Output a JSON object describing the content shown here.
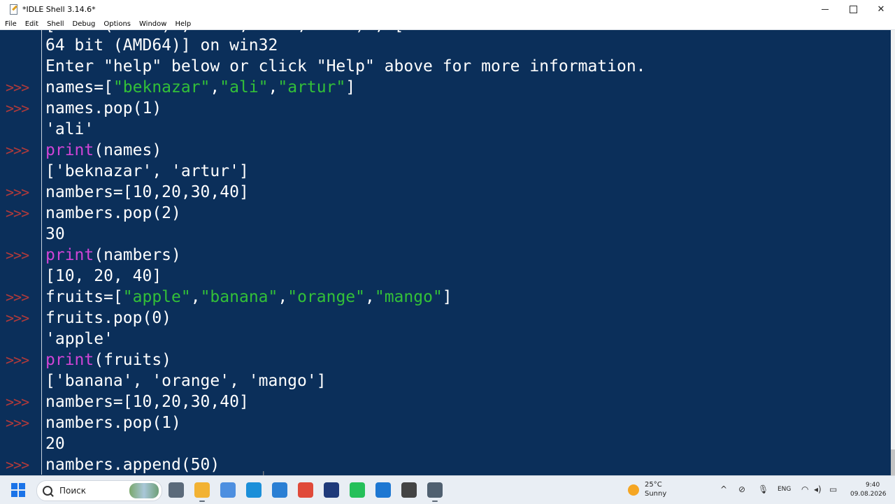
{
  "window": {
    "title": "*IDLE Shell 3.14.6*",
    "controls": {
      "minimize": "—",
      "maximize": "□",
      "close": "✕"
    }
  },
  "menu": [
    "File",
    "Edit",
    "Shell",
    "Debug",
    "Options",
    "Window",
    "Help"
  ],
  "shell": {
    "prompt": ">>>",
    "clipped_line": "[ ... ( ... ) , ... , ... , ... ) , [",
    "banner": [
      "64 bit (AMD64)] on win32",
      "Enter \"help\" below or click \"Help\" above for more information."
    ],
    "session": [
      {
        "kind": "input",
        "code": "names=[\"beknazar\",\"ali\",\"artur\"]"
      },
      {
        "kind": "input",
        "code": "names.pop(1)"
      },
      {
        "kind": "output",
        "code": "'ali'"
      },
      {
        "kind": "input",
        "code": "print(names)"
      },
      {
        "kind": "output",
        "code": "['beknazar', 'artur']"
      },
      {
        "kind": "input",
        "code": "nambers=[10,20,30,40]"
      },
      {
        "kind": "input",
        "code": "nambers.pop(2)"
      },
      {
        "kind": "output",
        "code": "30"
      },
      {
        "kind": "input",
        "code": "print(nambers)"
      },
      {
        "kind": "output",
        "code": "[10, 20, 40]"
      },
      {
        "kind": "input",
        "code": "fruits=[\"apple\",\"banana\",\"orange\",\"mango\"]"
      },
      {
        "kind": "input",
        "code": "fruits.pop(0)"
      },
      {
        "kind": "output",
        "code": "'apple'"
      },
      {
        "kind": "input",
        "code": "print(fruits)"
      },
      {
        "kind": "output",
        "code": "['banana', 'orange', 'mango']"
      },
      {
        "kind": "input",
        "code": "nambers=[10,20,30,40]"
      },
      {
        "kind": "input",
        "code": "nambers.pop(1)"
      },
      {
        "kind": "output",
        "code": "20"
      },
      {
        "kind": "input",
        "code": "nambers.append(50)"
      }
    ]
  },
  "colors": {
    "background": "#0b2f5a",
    "prompt": "#b23a3a",
    "keyword": "#d044d6",
    "string": "#33c038",
    "output": "#8fb4d8",
    "code": "#ffffff"
  },
  "taskbar": {
    "search_placeholder": "Поиск",
    "apps": [
      "task-view-icon",
      "file-explorer-icon",
      "copilot-icon",
      "edge-icon",
      "vscode-icon",
      "chrome-icon",
      "photoshop-icon",
      "whatsapp-icon",
      "azure-data-studio-icon",
      "chatgpt-icon",
      "idle-icon"
    ],
    "weather": {
      "temp": "25°C",
      "desc": "Sunny"
    },
    "language": "ENG",
    "time": "9:40",
    "date": "09.08.2026"
  }
}
